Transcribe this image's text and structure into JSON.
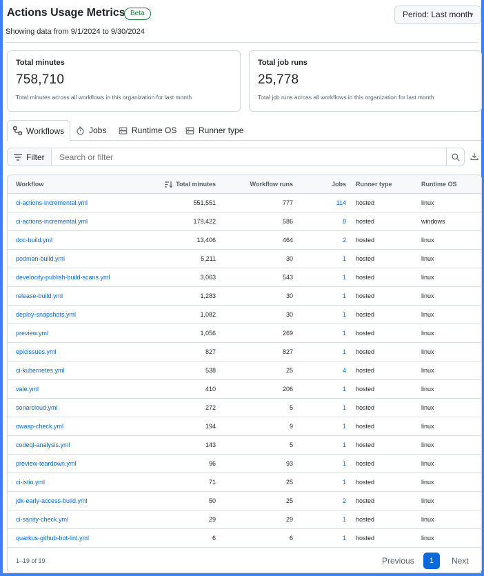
{
  "header": {
    "title": "Actions Usage Metrics",
    "badge": "Beta",
    "period_button": "Period: Last month",
    "subtitle": "Showing data from 9/1/2024 to 9/30/2024"
  },
  "cards": [
    {
      "label": "Total minutes",
      "value": "758,710",
      "desc": "Total minutes across all workflows in this organization for last month"
    },
    {
      "label": "Total job runs",
      "value": "25,778",
      "desc": "Total job runs across all workflows in this organization for last month"
    }
  ],
  "tabs": [
    {
      "label": "Workflows",
      "icon": "workflow-icon",
      "active": true
    },
    {
      "label": "Jobs",
      "icon": "stopwatch-icon",
      "active": false
    },
    {
      "label": "Runtime OS",
      "icon": "server-icon",
      "active": false
    },
    {
      "label": "Runner type",
      "icon": "server-icon",
      "active": false
    }
  ],
  "filter": {
    "button_label": "Filter",
    "placeholder": "Search or filter"
  },
  "table": {
    "headers": {
      "workflow": "Workflow",
      "total_minutes": "Total minutes",
      "workflow_runs": "Workflow runs",
      "jobs": "Jobs",
      "runner_type": "Runner type",
      "runtime_os": "Runtime OS"
    },
    "rows": [
      {
        "workflow": "ci-actions-incremental.yml",
        "minutes": "551,551",
        "runs": "777",
        "jobs": "114",
        "runner": "hosted",
        "os": "linux"
      },
      {
        "workflow": "ci-actions-incremental.yml",
        "minutes": "179,422",
        "runs": "586",
        "jobs": "8",
        "runner": "hosted",
        "os": "windows"
      },
      {
        "workflow": "doc-build.yml",
        "minutes": "13,406",
        "runs": "464",
        "jobs": "2",
        "runner": "hosted",
        "os": "linux"
      },
      {
        "workflow": "podman-build.yml",
        "minutes": "5,211",
        "runs": "30",
        "jobs": "1",
        "runner": "hosted",
        "os": "linux"
      },
      {
        "workflow": "develocity-publish-build-scans.yml",
        "minutes": "3,063",
        "runs": "543",
        "jobs": "1",
        "runner": "hosted",
        "os": "linux"
      },
      {
        "workflow": "release-build.yml",
        "minutes": "1,283",
        "runs": "30",
        "jobs": "1",
        "runner": "hosted",
        "os": "linux"
      },
      {
        "workflow": "deploy-snapshots.yml",
        "minutes": "1,082",
        "runs": "30",
        "jobs": "1",
        "runner": "hosted",
        "os": "linux"
      },
      {
        "workflow": "preview.yml",
        "minutes": "1,056",
        "runs": "269",
        "jobs": "1",
        "runner": "hosted",
        "os": "linux"
      },
      {
        "workflow": "epicissues.yml",
        "minutes": "827",
        "runs": "827",
        "jobs": "1",
        "runner": "hosted",
        "os": "linux"
      },
      {
        "workflow": "ci-kubernetes.yml",
        "minutes": "538",
        "runs": "25",
        "jobs": "4",
        "runner": "hosted",
        "os": "linux"
      },
      {
        "workflow": "vale.yml",
        "minutes": "410",
        "runs": "206",
        "jobs": "1",
        "runner": "hosted",
        "os": "linux"
      },
      {
        "workflow": "sonarcloud.yml",
        "minutes": "272",
        "runs": "5",
        "jobs": "1",
        "runner": "hosted",
        "os": "linux"
      },
      {
        "workflow": "owasp-check.yml",
        "minutes": "194",
        "runs": "9",
        "jobs": "1",
        "runner": "hosted",
        "os": "linux"
      },
      {
        "workflow": "codeql-analysis.yml",
        "minutes": "143",
        "runs": "5",
        "jobs": "1",
        "runner": "hosted",
        "os": "linux"
      },
      {
        "workflow": "preview-teardown.yml",
        "minutes": "96",
        "runs": "93",
        "jobs": "1",
        "runner": "hosted",
        "os": "linux"
      },
      {
        "workflow": "ci-istio.yml",
        "minutes": "71",
        "runs": "25",
        "jobs": "1",
        "runner": "hosted",
        "os": "linux"
      },
      {
        "workflow": "jdk-early-access-build.yml",
        "minutes": "50",
        "runs": "25",
        "jobs": "2",
        "runner": "hosted",
        "os": "linux"
      },
      {
        "workflow": "ci-sanity-check.yml",
        "minutes": "29",
        "runs": "29",
        "jobs": "1",
        "runner": "hosted",
        "os": "linux"
      },
      {
        "workflow": "quarkus-github-bot-lint.yml",
        "minutes": "6",
        "runs": "6",
        "jobs": "1",
        "runner": "hosted",
        "os": "linux"
      }
    ]
  },
  "pagination": {
    "count": "1–19 of 19",
    "previous": "Previous",
    "current": "1",
    "next": "Next"
  },
  "colors": {
    "link": "#0969da",
    "accent": "#0969da",
    "beta": "#1a7f37"
  }
}
